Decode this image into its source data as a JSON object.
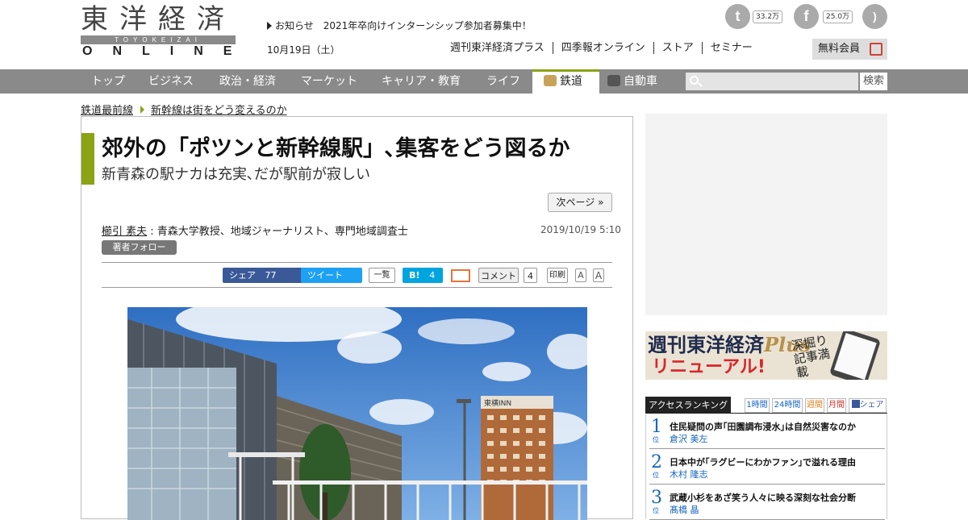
{
  "header": {
    "logo_kanji": "東洋経済",
    "logo_roman": "TOYOKEIZAI",
    "logo_online": "ONLINE",
    "notice_label": "お知らせ",
    "notice_text": "2021年卒向けインターンシップ参加者募集中！",
    "date": "10月19日（土）",
    "links": [
      "週刊東洋経済プラス",
      "四季報オンライン",
      "ストア",
      "セミナー"
    ],
    "member_label": "無料会員",
    "twitter_count": "33.2万",
    "facebook_count": "25.0万",
    "colors": {
      "accent": "#8ba314",
      "nav": "#8a8a8a"
    }
  },
  "nav": {
    "items": [
      "トップ",
      "ビジネス",
      "政治・経済",
      "マーケット",
      "キャリア・教育",
      "ライフ",
      "鉄道",
      "自動車"
    ],
    "active": "鉄道",
    "search_button": "検索"
  },
  "breadcrumb": [
    "鉄道最前線",
    "新幹線は街をどう変えるのか"
  ],
  "article": {
    "title": "郊外の「ポツンと新幹線駅」､集客をどう図るか",
    "subtitle": "新青森の駅ナカは充実､だが駅前が寂しい",
    "next_page": "次ページ »",
    "author_name": "櫛引 素夫",
    "author_desc": " : 青森大学教授、地域ジャーナリスト、専門地域調査士",
    "published": "2019/10/19 5:10",
    "follow_label": "著者フォロー",
    "share": {
      "facebook": "シェア",
      "facebook_count": "77",
      "tweet": "ツイート",
      "list": "一覧",
      "hatena": "B!",
      "hatena_count": "4",
      "comment": "コメント",
      "comment_count": "4",
      "print": "印刷",
      "font_small": "A",
      "font_large": "A"
    },
    "photo_sign": "東横INN"
  },
  "sidebar": {
    "banner_title": "週刊東洋経済",
    "banner_plus": "Plus",
    "banner_renewal": "リニューアル!",
    "banner_note": "深掘り記事満載",
    "ranking": {
      "title": "アクセスランキング",
      "tabs": [
        "1時間",
        "24時間",
        "週間",
        "月間",
        "シェア"
      ],
      "rank_suffix": "位",
      "items": [
        {
          "rank": "1",
          "title": "住民疑問の声｢田園調布浸水｣は自然災害なのか",
          "author": "倉沢 美左"
        },
        {
          "rank": "2",
          "title": "日本中が｢ラグビーにわかファン｣で溢れる理由",
          "author": "木村 隆志"
        },
        {
          "rank": "3",
          "title": "武蔵小杉をあざ笑う人々に映る深刻な社会分断",
          "author": "髙橋 晶"
        }
      ]
    }
  }
}
